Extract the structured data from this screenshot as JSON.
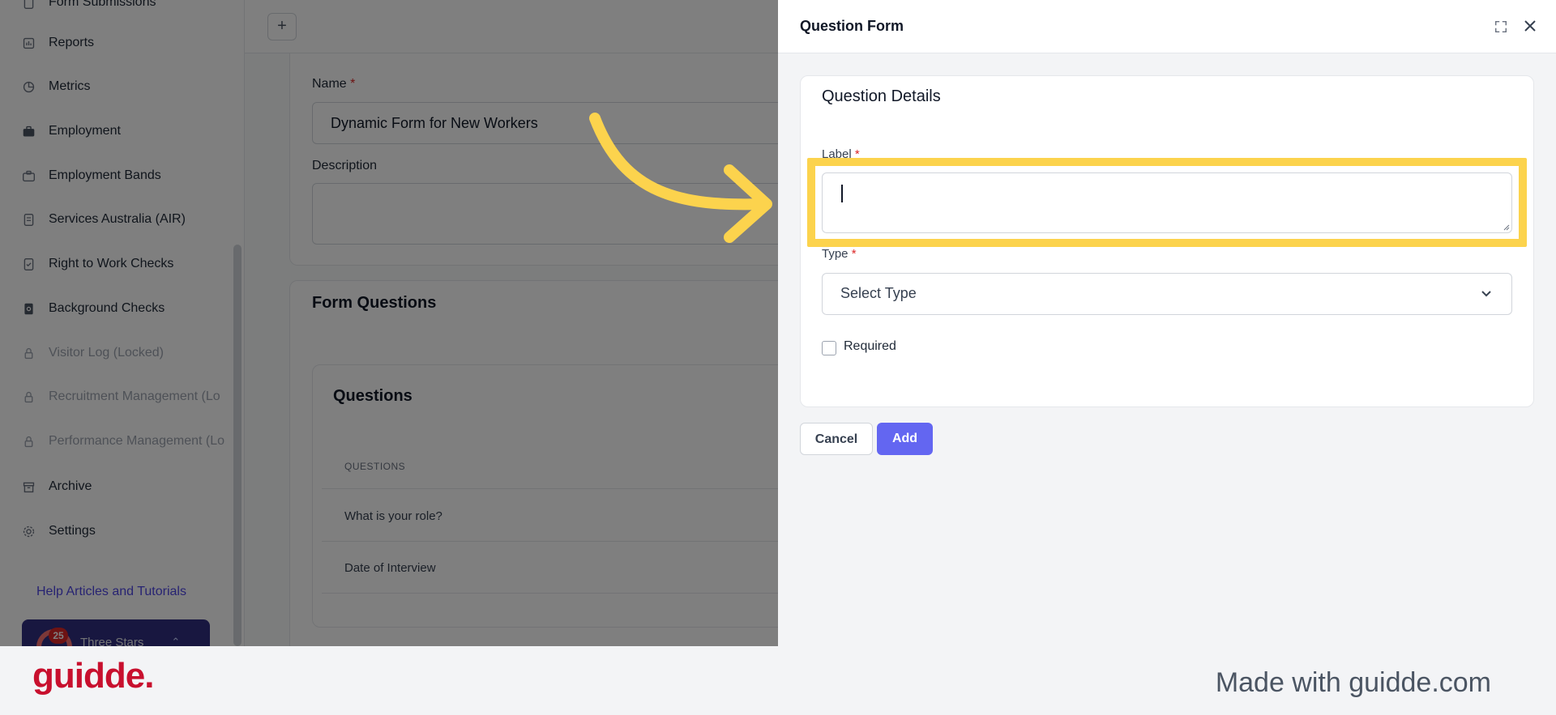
{
  "sidebar": {
    "items": [
      {
        "label": "Form Submissions",
        "icon": "form-icon",
        "locked": false
      },
      {
        "label": "Reports",
        "icon": "reports-icon",
        "locked": false
      },
      {
        "label": "Metrics",
        "icon": "pie-chart-icon",
        "locked": false
      },
      {
        "label": "Employment",
        "icon": "briefcase-icon",
        "locked": false
      },
      {
        "label": "Employment Bands",
        "icon": "briefcase-outline-icon",
        "locked": false
      },
      {
        "label": "Services Australia (AIR)",
        "icon": "document-icon",
        "locked": false
      },
      {
        "label": "Right to Work Checks",
        "icon": "document-check-icon",
        "locked": false
      },
      {
        "label": "Background Checks",
        "icon": "document-search-icon",
        "locked": false
      },
      {
        "label": "Visitor Log (Locked)",
        "icon": "lock-icon",
        "locked": true
      },
      {
        "label": "Recruitment Management (Lo",
        "icon": "lock-icon",
        "locked": true
      },
      {
        "label": "Performance Management (Lo",
        "icon": "lock-icon",
        "locked": true
      },
      {
        "label": "Archive",
        "icon": "archive-icon",
        "locked": false
      },
      {
        "label": "Settings",
        "icon": "gear-icon",
        "locked": false
      }
    ],
    "help_link": "Help Articles and Tutorials",
    "workspace": {
      "name": "Three Stars",
      "badge": "25"
    }
  },
  "topbar": {
    "new_tab": "+"
  },
  "form": {
    "name_label": "Name",
    "name_required": "*",
    "name_value": "Dynamic Form for New Workers",
    "description_label": "Description"
  },
  "form_questions": {
    "title": "Form Questions",
    "questions_title": "Questions",
    "column_header": "QUESTIONS",
    "rows": [
      "What is your role?",
      "Date of Interview"
    ]
  },
  "modal": {
    "title": "Question Form",
    "details_title": "Question Details",
    "label_label": "Label",
    "label_required": "*",
    "label_value": "",
    "type_label": "Type",
    "type_required": "*",
    "type_placeholder": "Select Type",
    "required_label": "Required",
    "required_checked": false,
    "cancel_label": "Cancel",
    "add_label": "Add"
  },
  "footer": {
    "brand": "guidde.",
    "made_with": "Made with guidde.com"
  },
  "colors": {
    "accent": "#6366f1",
    "highlight": "#fcd34d",
    "brand": "#c8102e",
    "required": "#dc2626"
  }
}
